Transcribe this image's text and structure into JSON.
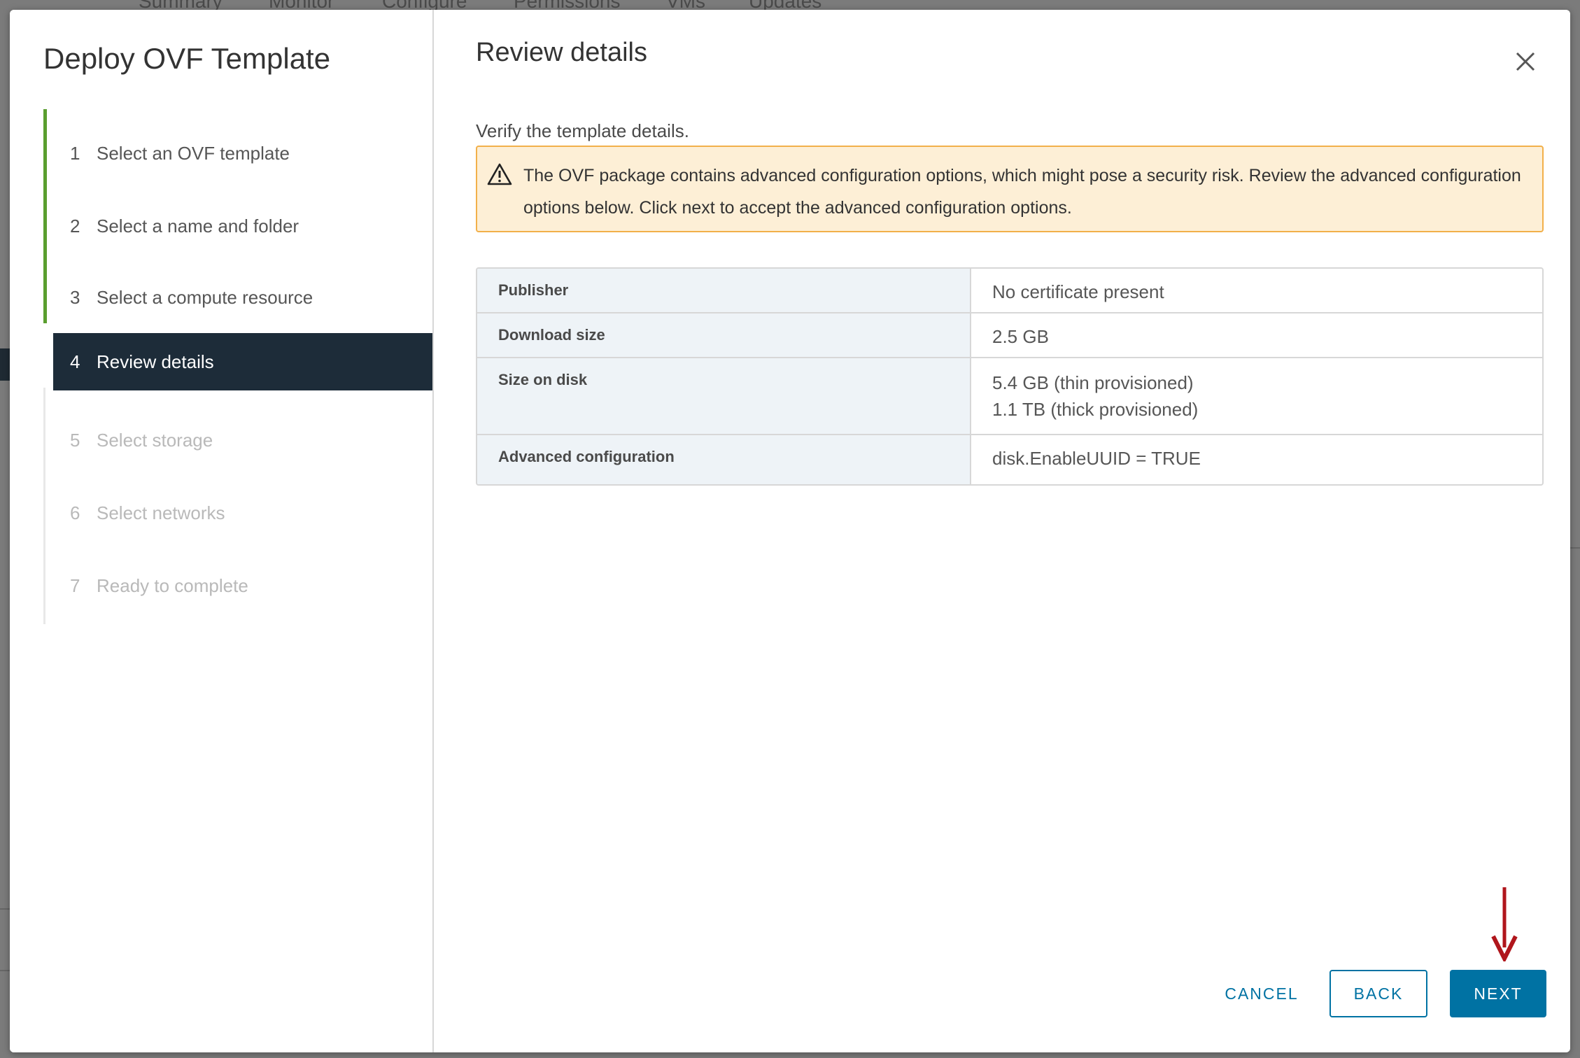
{
  "background": {
    "tabs": [
      "Summary",
      "Monitor",
      "Configure",
      "Permissions",
      "VMs",
      "Updates"
    ]
  },
  "wizard": {
    "title": "Deploy OVF Template",
    "steps": [
      {
        "num": "1",
        "label": "Select an OVF template",
        "state": "done"
      },
      {
        "num": "2",
        "label": "Select a name and folder",
        "state": "done"
      },
      {
        "num": "3",
        "label": "Select a compute resource",
        "state": "done"
      },
      {
        "num": "4",
        "label": "Review details",
        "state": "active"
      },
      {
        "num": "5",
        "label": "Select storage",
        "state": "pending"
      },
      {
        "num": "6",
        "label": "Select networks",
        "state": "pending"
      },
      {
        "num": "7",
        "label": "Ready to complete",
        "state": "pending"
      }
    ]
  },
  "main": {
    "title": "Review details",
    "subtitle": "Verify the template details.",
    "alert": {
      "text": "The OVF package contains advanced configuration options, which might pose a security risk. Review the advanced configuration options below. Click next to accept the advanced configuration options.",
      "icon": "warning-triangle-icon"
    },
    "details": [
      {
        "key": "Publisher",
        "values": [
          "No certificate present"
        ]
      },
      {
        "key": "Download size",
        "values": [
          "2.5 GB"
        ]
      },
      {
        "key": "Size on disk",
        "values": [
          "5.4 GB (thin provisioned)",
          "1.1 TB (thick provisioned)"
        ]
      },
      {
        "key": "Advanced configuration",
        "values": [
          "disk.EnableUUID = TRUE"
        ]
      }
    ]
  },
  "footer": {
    "cancel_label": "CANCEL",
    "back_label": "BACK",
    "next_label": "NEXT"
  },
  "colors": {
    "accent": "#0072a3",
    "active_step_bg": "#1d2c39",
    "done_rail": "#5a9e2f",
    "alert_bg": "#fdefd6",
    "alert_border": "#f2b04a",
    "annotation_arrow": "#b0161c"
  }
}
